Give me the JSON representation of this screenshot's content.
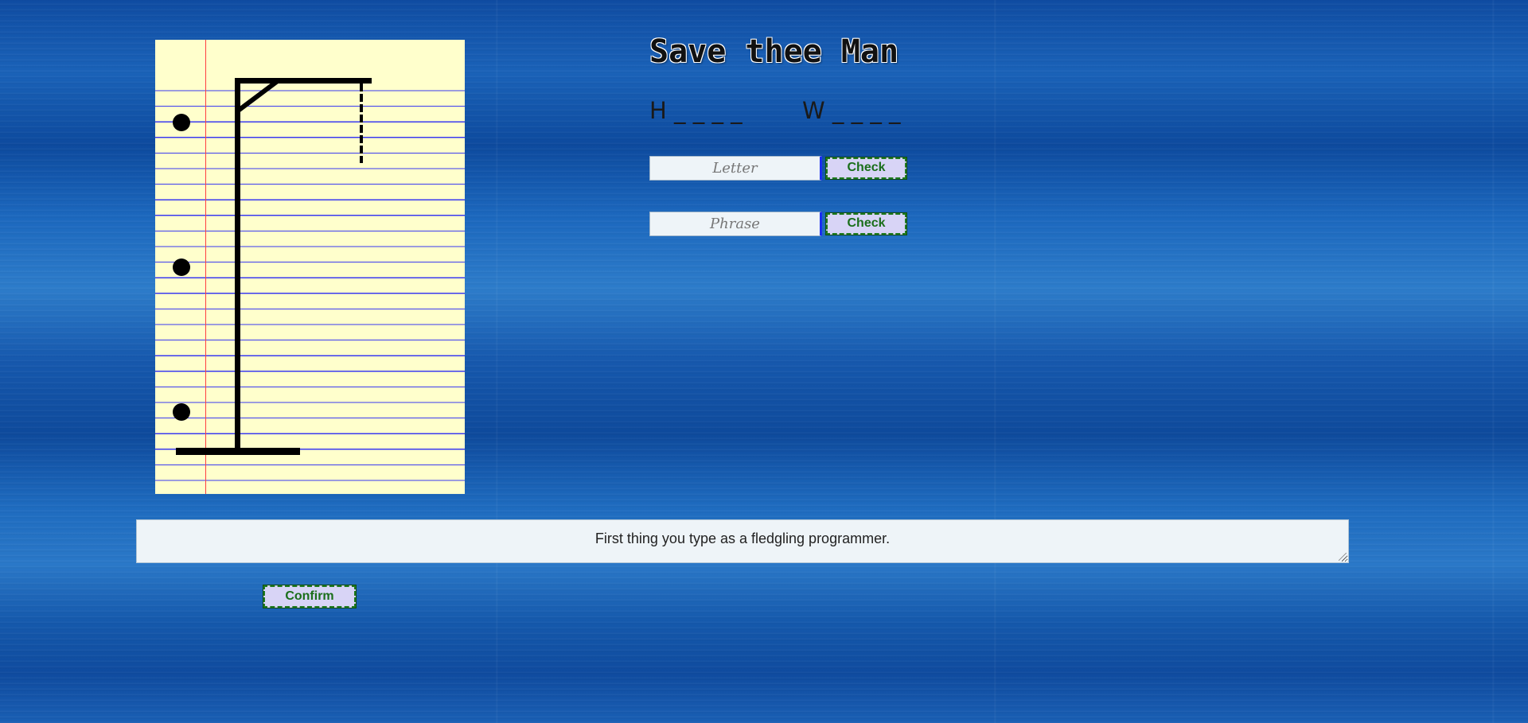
{
  "game": {
    "title": "Save thee Man",
    "words": [
      "H _ _ _ _",
      "W _ _ _ _"
    ]
  },
  "letter_guess": {
    "placeholder": "Letter",
    "value": "",
    "button_label": "Check"
  },
  "phrase_guess": {
    "placeholder": "Phrase",
    "value": "",
    "button_label": "Check"
  },
  "hint": {
    "text": "First thing you type as a fledgling programmer."
  },
  "confirm": {
    "label": "Confirm"
  },
  "colors": {
    "paper": "#ffffcc",
    "rule_lines": "#3a3af0",
    "margin_line": "#ff4040",
    "button_bg": "#d8d4f6",
    "button_text": "#1a6e1a",
    "input_bg": "#eef4f8"
  }
}
